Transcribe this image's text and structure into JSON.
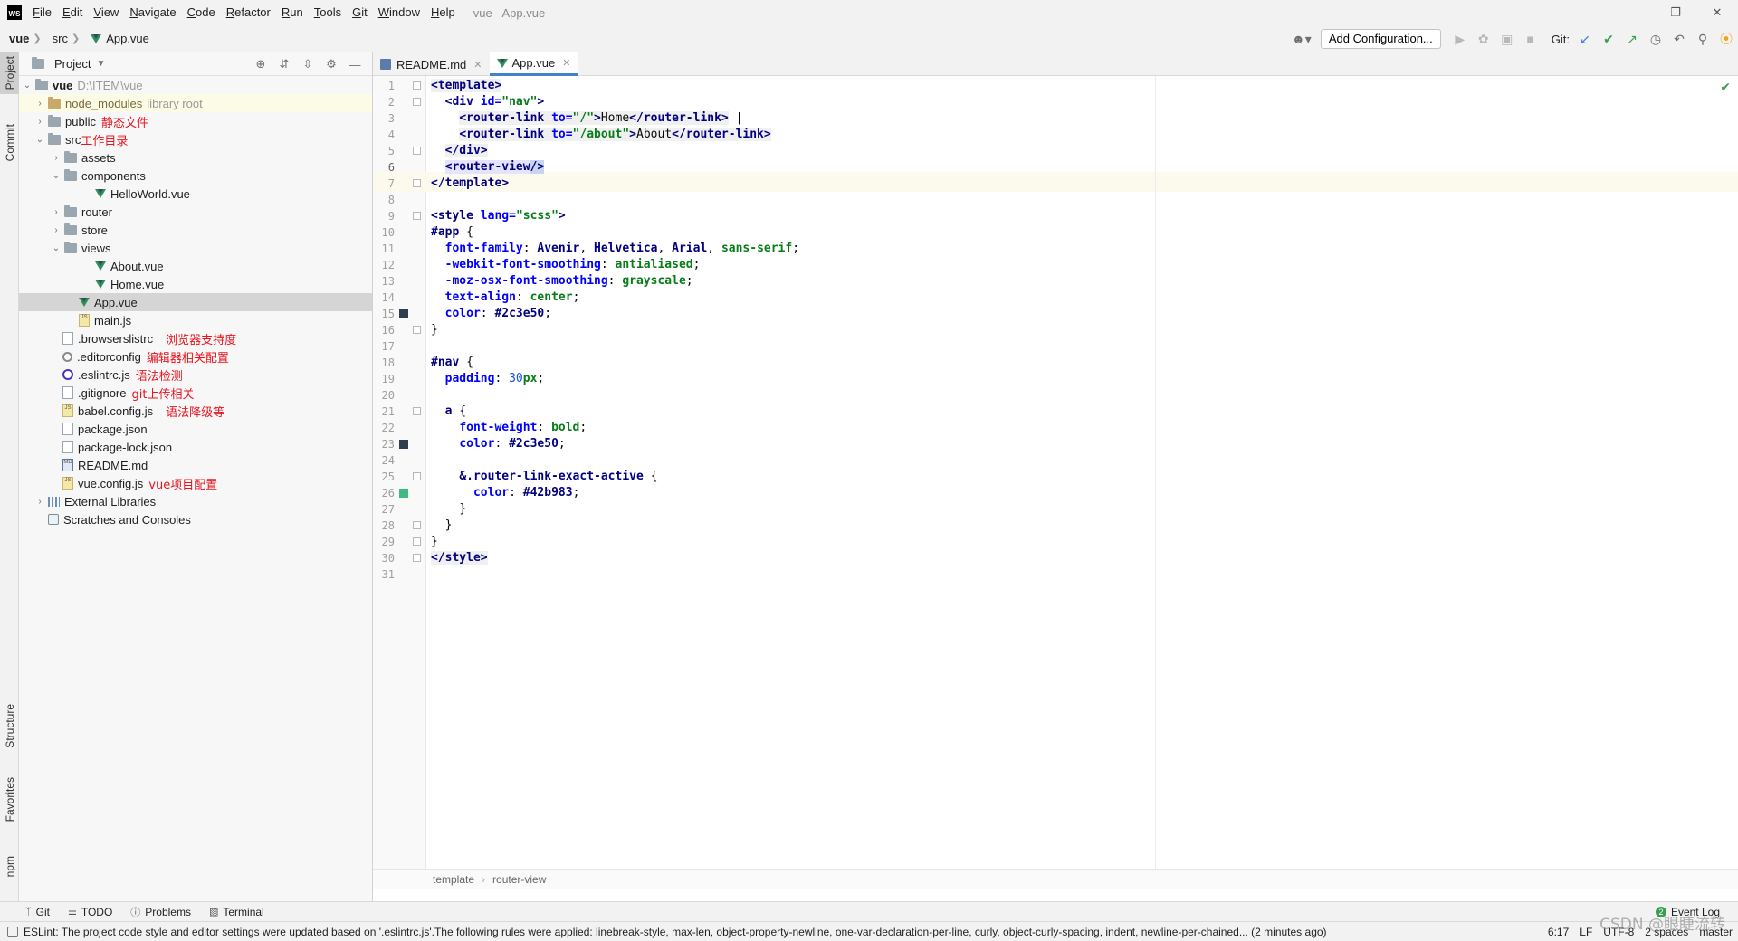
{
  "menubar": {
    "logo": "WS",
    "items": [
      "File",
      "Edit",
      "View",
      "Navigate",
      "Code",
      "Refactor",
      "Run",
      "Tools",
      "Git",
      "Window",
      "Help"
    ],
    "window_title": "vue - App.vue"
  },
  "navbar": {
    "crumbs": [
      "vue",
      "src",
      "App.vue"
    ],
    "add_config_label": "Add Configuration...",
    "git_label": "Git:"
  },
  "left_strip": {
    "project": "Project",
    "commit": "Commit",
    "structure": "Structure",
    "favorites": "Favorites",
    "npm": "npm"
  },
  "project_panel": {
    "title": "Project",
    "tree": [
      {
        "name": "vue",
        "extra": "D:\\ITEM\\vue",
        "annot": ""
      },
      {
        "name": "node_modules",
        "extra": "library root",
        "annot": ""
      },
      {
        "name": "public",
        "extra": "",
        "annot": "静态文件"
      },
      {
        "name": "src",
        "extra": "",
        "annot": "工作目录"
      },
      {
        "name": "assets",
        "extra": "",
        "annot": ""
      },
      {
        "name": "components",
        "extra": "",
        "annot": ""
      },
      {
        "name": "HelloWorld.vue",
        "extra": "",
        "annot": ""
      },
      {
        "name": "router",
        "extra": "",
        "annot": ""
      },
      {
        "name": "store",
        "extra": "",
        "annot": ""
      },
      {
        "name": "views",
        "extra": "",
        "annot": ""
      },
      {
        "name": "About.vue",
        "extra": "",
        "annot": ""
      },
      {
        "name": "Home.vue",
        "extra": "",
        "annot": ""
      },
      {
        "name": "App.vue",
        "extra": "",
        "annot": ""
      },
      {
        "name": "main.js",
        "extra": "",
        "annot": ""
      },
      {
        "name": ".browserslistrc",
        "extra": "",
        "annot": "浏览器支持度"
      },
      {
        "name": ".editorconfig",
        "extra": "",
        "annot": "编辑器相关配置"
      },
      {
        "name": ".eslintrc.js",
        "extra": "",
        "annot": "语法检测"
      },
      {
        "name": ".gitignore",
        "extra": "",
        "annot": "git上传相关"
      },
      {
        "name": "babel.config.js",
        "extra": "",
        "annot": "语法降级等"
      },
      {
        "name": "package.json",
        "extra": "",
        "annot": ""
      },
      {
        "name": "package-lock.json",
        "extra": "",
        "annot": ""
      },
      {
        "name": "README.md",
        "extra": "",
        "annot": ""
      },
      {
        "name": "vue.config.js",
        "extra": "",
        "annot": "vue项目配置"
      },
      {
        "name": "External Libraries",
        "extra": "",
        "annot": ""
      },
      {
        "name": "Scratches and Consoles",
        "extra": "",
        "annot": ""
      }
    ]
  },
  "editor": {
    "tabs": [
      {
        "label": "README.md"
      },
      {
        "label": "App.vue"
      }
    ],
    "line_numbers": [
      "1",
      "2",
      "3",
      "4",
      "5",
      "6",
      "7",
      "8",
      "9",
      "10",
      "11",
      "12",
      "13",
      "14",
      "15",
      "16",
      "17",
      "18",
      "19",
      "20",
      "21",
      "22",
      "23",
      "24",
      "25",
      "26",
      "27",
      "28",
      "29",
      "30",
      "31"
    ],
    "code": {
      "l1": [
        "<template>"
      ],
      "l2": [
        "<div ",
        "id=",
        "\"nav\"",
        ">"
      ],
      "l3": [
        "<router-link ",
        "to=",
        "\"/\"",
        ">",
        "Home",
        "</router-link>",
        " |"
      ],
      "l4": [
        "<router-link ",
        "to=",
        "\"/about\"",
        ">",
        "About",
        "</router-link>"
      ],
      "l5": [
        "</div>"
      ],
      "l6": [
        "<router-view",
        "/>"
      ],
      "l7": [
        "</template>"
      ],
      "l9": [
        "<style ",
        "lang=",
        "\"scss\"",
        ">"
      ],
      "l10": [
        "#app",
        " {"
      ],
      "l11": [
        "font-family",
        ": ",
        "Avenir",
        ", ",
        "Helvetica",
        ", ",
        "Arial",
        ", ",
        "sans-serif",
        ";"
      ],
      "l12": [
        "-webkit-font-smoothing",
        ": ",
        "antialiased",
        ";"
      ],
      "l13": [
        "-moz-osx-font-smoothing",
        ": ",
        "grayscale",
        ";"
      ],
      "l14": [
        "text-align",
        ": ",
        "center",
        ";"
      ],
      "l15": [
        "color",
        ": ",
        "#2c3e50",
        ";"
      ],
      "l16": [
        "}"
      ],
      "l18": [
        "#nav",
        " {"
      ],
      "l19": [
        "padding",
        ": ",
        "30",
        "px",
        ";"
      ],
      "l21": [
        "a",
        " {"
      ],
      "l22": [
        "font-weight",
        ": ",
        "bold",
        ";"
      ],
      "l23": [
        "color",
        ": ",
        "#2c3e50",
        ";"
      ],
      "l25": [
        "&.router-link-exact-active",
        " {"
      ],
      "l26": [
        "color",
        ": ",
        "#42b983",
        ";"
      ],
      "l27": [
        "}"
      ],
      "l28": [
        "}"
      ],
      "l29": [
        "}"
      ],
      "l30": [
        "</style>"
      ]
    },
    "swatch_colors": {
      "l15": "#2c3e50",
      "l23": "#2c3e50",
      "l26": "#42b983"
    },
    "breadcrumb": [
      "template",
      "router-view"
    ]
  },
  "bottom_tools": [
    "Git",
    "TODO",
    "Problems",
    "Terminal"
  ],
  "event_log": "Event Log",
  "event_log_count": "2",
  "status": {
    "message": "ESLint: The project code style and editor settings were updated based on '.eslintrc.js'.The following rules were applied: linebreak-style, max-len, object-property-newline, one-var-declaration-per-line, curly, object-curly-spacing, indent, newline-per-chained... (2 minutes ago)",
    "position": "6:17",
    "line_sep": "LF",
    "encoding": "UTF-8",
    "indent": "2 spaces",
    "branch": "master"
  },
  "watermark": "CSDN @眼睫流转"
}
